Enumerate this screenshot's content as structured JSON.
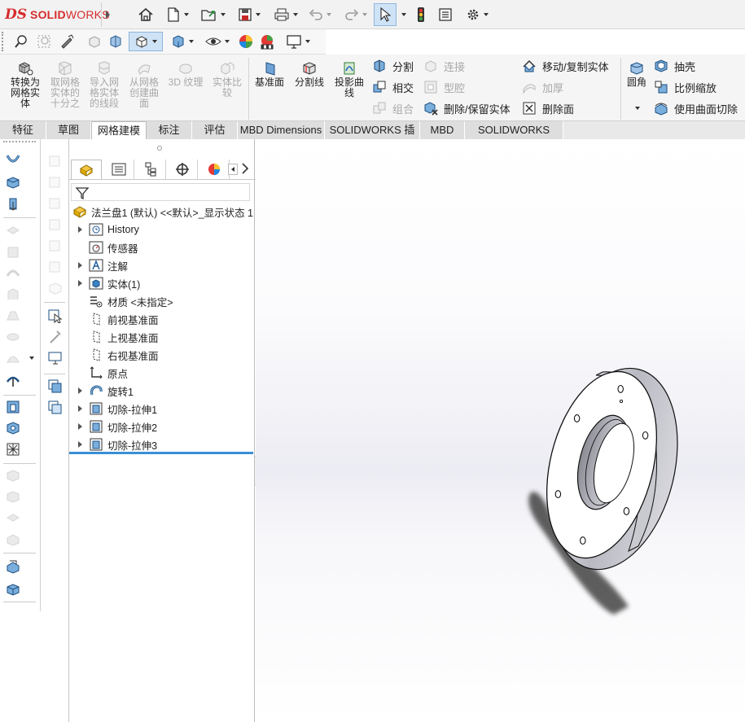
{
  "app": {
    "logo_mark": "DS",
    "brand_bold": "SOLID",
    "brand_light": "WORKS"
  },
  "colors": {
    "accent": "#d62c2c",
    "selection": "#3a8fd6",
    "highlight": "#cfe3f7"
  },
  "title_toolbar": {
    "icons": [
      "home-icon",
      "new-document-icon",
      "open-folder-icon",
      "save-icon",
      "print-icon",
      "undo-icon",
      "redo-icon",
      "select-cursor-icon",
      "traffic-light-icon",
      "file-properties-icon",
      "options-gear-icon"
    ]
  },
  "view_toolbar": {
    "icons": [
      "zoom-to-fit-icon",
      "zoom-area-icon",
      "previous-view-icon",
      "section-view-icon",
      "view-orientation-icon",
      "display-style-icon",
      "hide-show-icon",
      "edit-appearance-icon",
      "apply-scene-icon",
      "view-settings-icon"
    ]
  },
  "command_manager": {
    "large_buttons": [
      {
        "label": "转换为\n网格实\n体",
        "enabled": true
      },
      {
        "label": "取网格\n实体的\n十分之",
        "enabled": false
      },
      {
        "label": "导入网\n格实体\n的线段",
        "enabled": false
      },
      {
        "label": "从网格\n创建曲\n面",
        "enabled": false
      },
      {
        "label": "3D 纹理",
        "enabled": false
      },
      {
        "label": "实体比\n较",
        "enabled": false
      },
      {
        "label": "基准面",
        "enabled": true
      },
      {
        "label": "分割线",
        "enabled": true
      },
      {
        "label": "投影曲\n线",
        "enabled": true
      }
    ],
    "small_buttons": [
      {
        "label": "分割",
        "enabled": true
      },
      {
        "label": "相交",
        "enabled": true
      },
      {
        "label": "组合",
        "enabled": false
      },
      {
        "label": "连接",
        "enabled": false
      },
      {
        "label": "型腔",
        "enabled": false
      },
      {
        "label": "删除/保留实体",
        "enabled": true
      },
      {
        "label": "移动/复制实体",
        "enabled": true
      },
      {
        "label": "加厚",
        "enabled": false
      },
      {
        "label": "删除面",
        "enabled": true
      },
      {
        "label": "抽壳",
        "enabled": true
      },
      {
        "label": "比例缩放",
        "enabled": true
      },
      {
        "label": "使用曲面切除",
        "enabled": true
      }
    ],
    "fillet_label": "圆角"
  },
  "tabs": [
    {
      "label": "特征",
      "active": false
    },
    {
      "label": "草图",
      "active": false
    },
    {
      "label": "网格建模",
      "active": true
    },
    {
      "label": "标注",
      "active": false
    },
    {
      "label": "评估",
      "active": false
    },
    {
      "label": "MBD Dimensions",
      "active": false
    },
    {
      "label": "SOLIDWORKS 插件",
      "active": false
    },
    {
      "label": "MBD",
      "active": false
    },
    {
      "label": "SOLIDWORKS CAM",
      "active": false
    }
  ],
  "feature_tree": {
    "root": "法兰盘1 (默认) <<默认>_显示状态 1",
    "items": [
      {
        "label": "History",
        "expandable": true,
        "icon": "history-folder-icon"
      },
      {
        "label": "传感器",
        "expandable": false,
        "icon": "sensor-icon"
      },
      {
        "label": "注解",
        "expandable": true,
        "icon": "annotation-icon"
      },
      {
        "label": "实体(1)",
        "expandable": true,
        "icon": "solid-bodies-icon"
      },
      {
        "label": "材质 <未指定>",
        "expandable": false,
        "icon": "material-icon"
      },
      {
        "label": "前视基准面",
        "expandable": false,
        "icon": "plane-icon"
      },
      {
        "label": "上视基准面",
        "expandable": false,
        "icon": "plane-icon"
      },
      {
        "label": "右视基准面",
        "expandable": false,
        "icon": "plane-icon"
      },
      {
        "label": "原点",
        "expandable": false,
        "icon": "origin-icon"
      },
      {
        "label": "旋转1",
        "expandable": true,
        "icon": "revolve-icon"
      },
      {
        "label": "切除-拉伸1",
        "expandable": true,
        "icon": "cut-extrude-icon"
      },
      {
        "label": "切除-拉伸2",
        "expandable": true,
        "icon": "cut-extrude-icon"
      },
      {
        "label": "切除-拉伸3",
        "expandable": true,
        "icon": "cut-extrude-icon"
      }
    ]
  },
  "graphics": {
    "model": "flange-part",
    "holes": 6
  }
}
